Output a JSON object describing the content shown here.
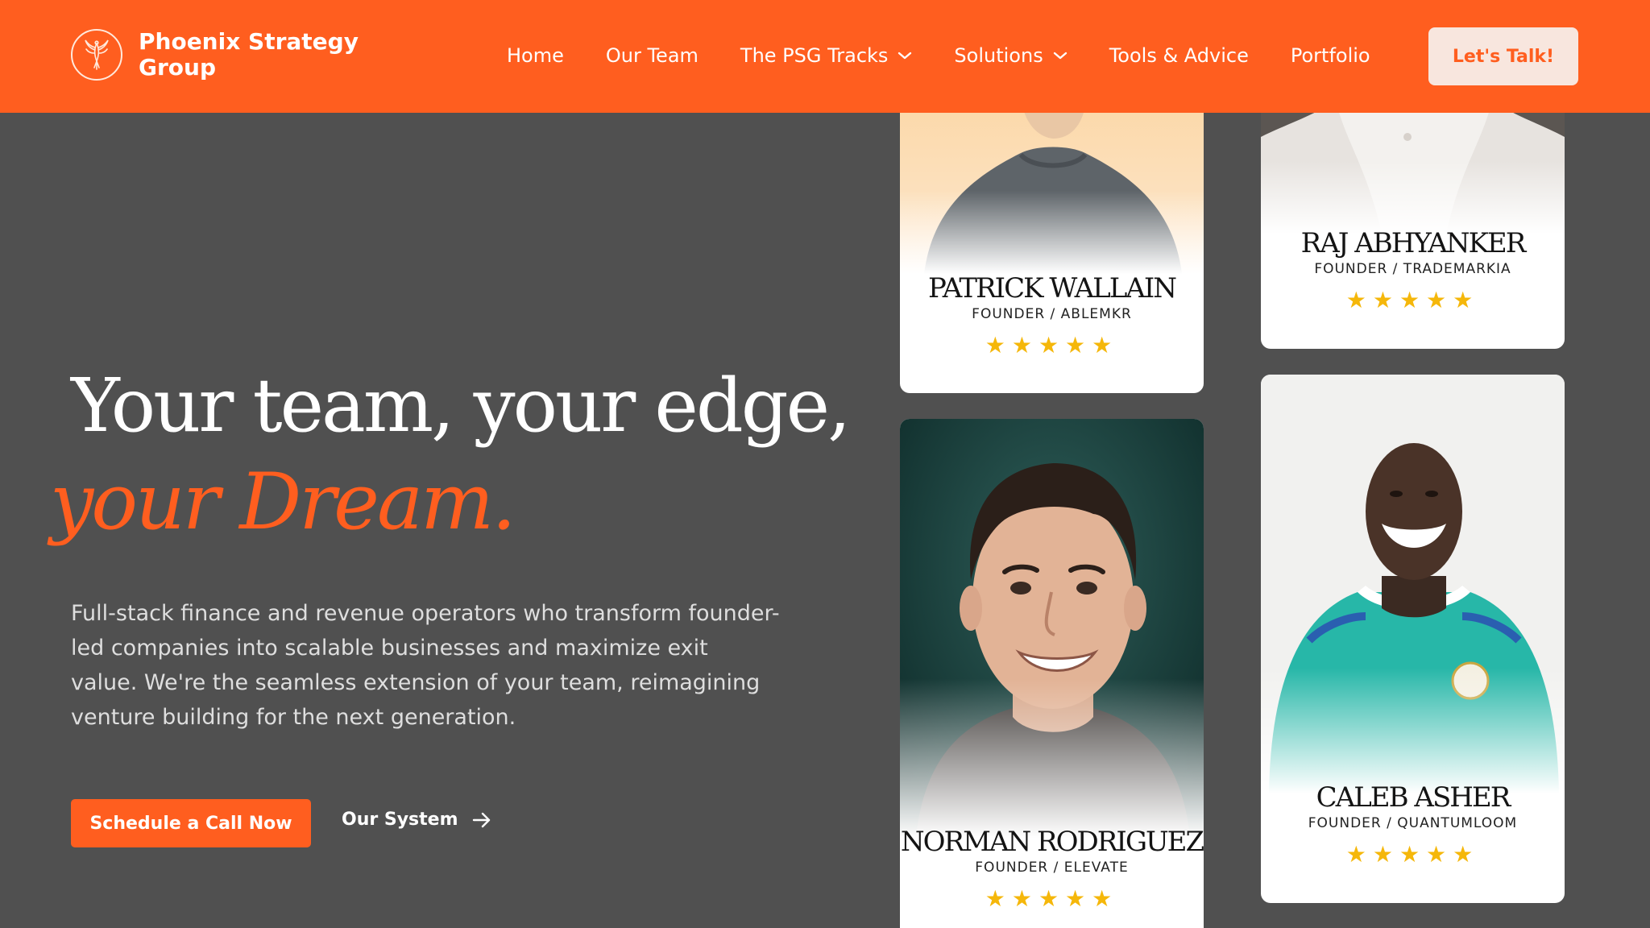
{
  "brand": {
    "name": "Phoenix Strategy Group",
    "logo": "phoenix-bird-icon"
  },
  "nav": {
    "items": [
      {
        "label": "Home"
      },
      {
        "label": "Our Team"
      },
      {
        "label": "The PSG Tracks",
        "icon": "chevron-down-icon"
      },
      {
        "label": "Solutions",
        "icon": "chevron-down-icon"
      },
      {
        "label": "Tools & Advice"
      },
      {
        "label": "Portfolio"
      }
    ],
    "cta": "Let's Talk!"
  },
  "hero": {
    "headline": "Your team, your edge,",
    "headline_accent": "your Dream.",
    "lede": "Full-stack finance and revenue operators who transform founder-led companies into scalable businesses and maximize exit value. We're the seamless extension of your team, reimagining venture building for the next generation.",
    "primary_cta": "Schedule a Call Now",
    "secondary_cta": "Our System",
    "secondary_icon": "arrow-right-icon"
  },
  "testimonials": [
    {
      "name": "PATRICK WALLAIN",
      "role": "FOUNDER / ABLEMKR",
      "rating": 5,
      "stars": "★★★★★"
    },
    {
      "name": "RAJ ABHYANKER",
      "role": "FOUNDER / TRADEMARKIA",
      "rating": 5,
      "stars": "★★★★★"
    },
    {
      "name": "NORMAN RODRIGUEZ",
      "role": "FOUNDER / ELEVATE",
      "rating": 5,
      "stars": "★★★★★"
    },
    {
      "name": "CALEB ASHER",
      "role": "FOUNDER / QUANTUMLOOM",
      "rating": 5,
      "stars": "★★★★★"
    }
  ],
  "colors": {
    "brand_orange": "#ff5e1f",
    "page_background": "#505050",
    "cta_background": "#f8e6de",
    "star": "#f5b70a"
  }
}
